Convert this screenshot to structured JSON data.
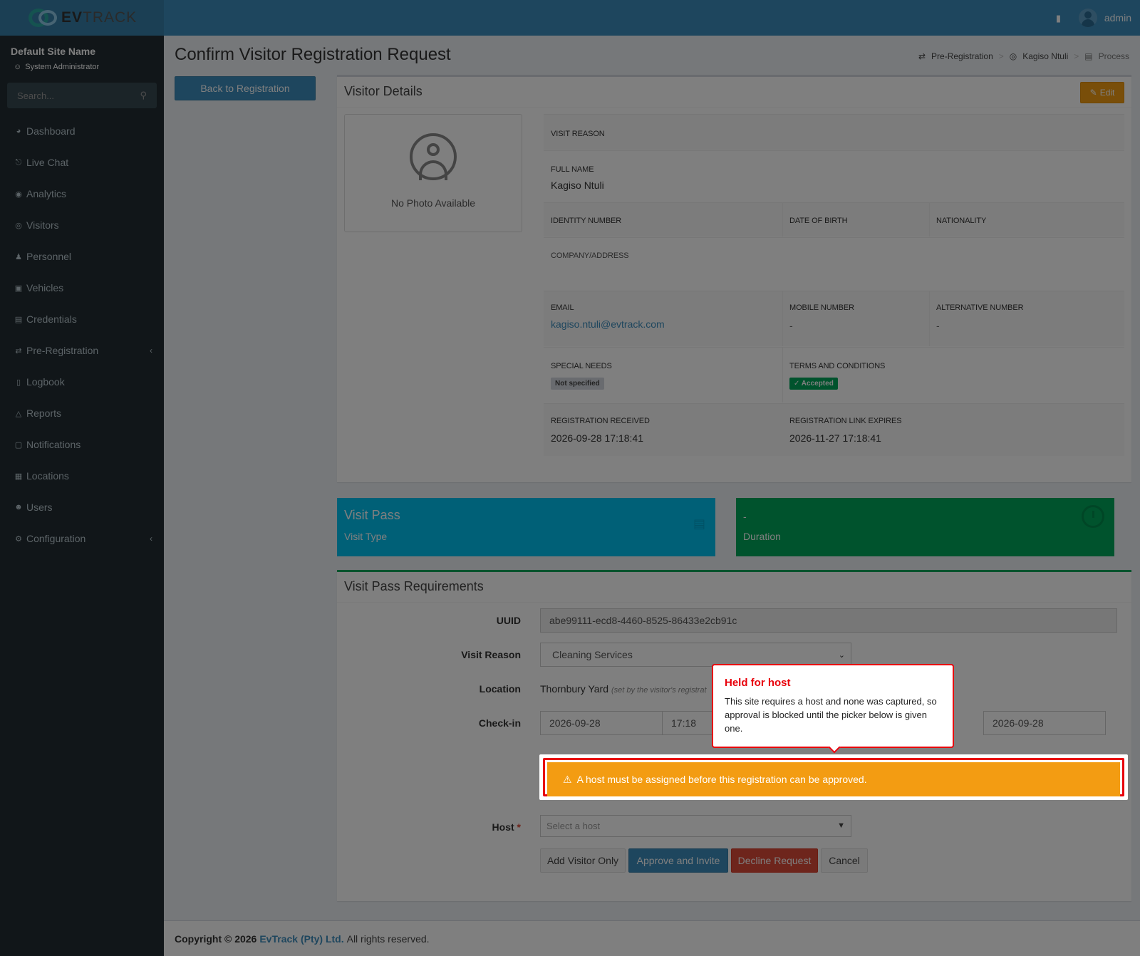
{
  "brand": {
    "logo_main": "EV",
    "logo_rest": "TRACK"
  },
  "topbar": {
    "username": "admin"
  },
  "sidebar": {
    "site_name": "Default Site Name",
    "role": "System Administrator",
    "search_placeholder": "Search...",
    "items": [
      {
        "label": "Dashboard",
        "icon": "dashboard-icon"
      },
      {
        "label": "Live Chat",
        "icon": "headset-icon"
      },
      {
        "label": "Analytics",
        "icon": "target-icon"
      },
      {
        "label": "Visitors",
        "icon": "eye-icon"
      },
      {
        "label": "Personnel",
        "icon": "users-icon"
      },
      {
        "label": "Vehicles",
        "icon": "car-icon"
      },
      {
        "label": "Credentials",
        "icon": "id-card-icon"
      },
      {
        "label": "Pre-Registration",
        "icon": "exchange-icon"
      },
      {
        "label": "Logbook",
        "icon": "book-icon"
      },
      {
        "label": "Reports",
        "icon": "chart-icon"
      },
      {
        "label": "Notifications",
        "icon": "chat-icon"
      },
      {
        "label": "Locations",
        "icon": "map-icon"
      },
      {
        "label": "Users",
        "icon": "user-cog-icon"
      },
      {
        "label": "Configuration",
        "icon": "gear-icon"
      }
    ]
  },
  "page": {
    "title": "Confirm Visitor Registration Request",
    "back_button": "Back to Registration",
    "breadcrumb": [
      "Pre-Registration",
      "Kagiso Ntuli",
      "Process"
    ]
  },
  "visitor_details": {
    "title": "Visitor Details",
    "edit_label": "Edit",
    "no_photo": "No Photo Available",
    "labels": {
      "visit_reason": "VISIT REASON",
      "full_name": "FULL NAME",
      "identity_number": "IDENTITY NUMBER",
      "date_of_birth": "DATE OF BIRTH",
      "nationality": "NATIONALITY",
      "company_address": "COMPANY/ADDRESS",
      "email": "EMAIL",
      "mobile": "MOBILE NUMBER",
      "alt_number": "ALTERNATIVE NUMBER",
      "special_needs": "SPECIAL NEEDS",
      "terms": "TERMS AND CONDITIONS",
      "received": "REGISTRATION RECEIVED",
      "expires": "REGISTRATION LINK EXPIRES"
    },
    "values": {
      "full_name": "Kagiso Ntuli",
      "email": "kagiso.ntuli@evtrack.com",
      "mobile": "-",
      "alt_number": "-",
      "special_needs": "Not specified",
      "terms": "Accepted",
      "received": "2026-09-28 17:18:41",
      "expires": "2026-11-27 17:18:41"
    }
  },
  "info_boxes": {
    "visit_pass": {
      "big": "Visit Pass",
      "small": "Visit Type"
    },
    "duration": {
      "big": "-",
      "small": "Duration"
    }
  },
  "requirements": {
    "title": "Visit Pass Requirements",
    "uuid_label": "UUID",
    "uuid_value": "abe99111-ecd8-4460-8525-86433e2cb91c",
    "reason_label": "Visit Reason",
    "reason_value": "Cleaning Services",
    "location_label": "Location",
    "location_value": "Thornbury Yard",
    "location_note": "(set by the visitor's registrat",
    "checkin_label": "Check-in",
    "checkin_date": "2026-09-28",
    "checkin_time": "17:18",
    "checkout_date": "2026-09-28",
    "warning": "A host must be assigned before this registration can be approved.",
    "host_label": "Host",
    "host_placeholder": "Select a host",
    "buttons": {
      "add_visitor": "Add Visitor Only",
      "approve": "Approve and Invite",
      "decline": "Decline Request",
      "cancel": "Cancel"
    }
  },
  "tooltip": {
    "title": "Held for host",
    "body": "This site requires a host and none was captured, so approval is blocked until the picker below is given one."
  },
  "footer": {
    "prefix": "Copyright © 2026",
    "brand": "EvTrack (Pty) Ltd.",
    "suffix": "All rights reserved."
  }
}
